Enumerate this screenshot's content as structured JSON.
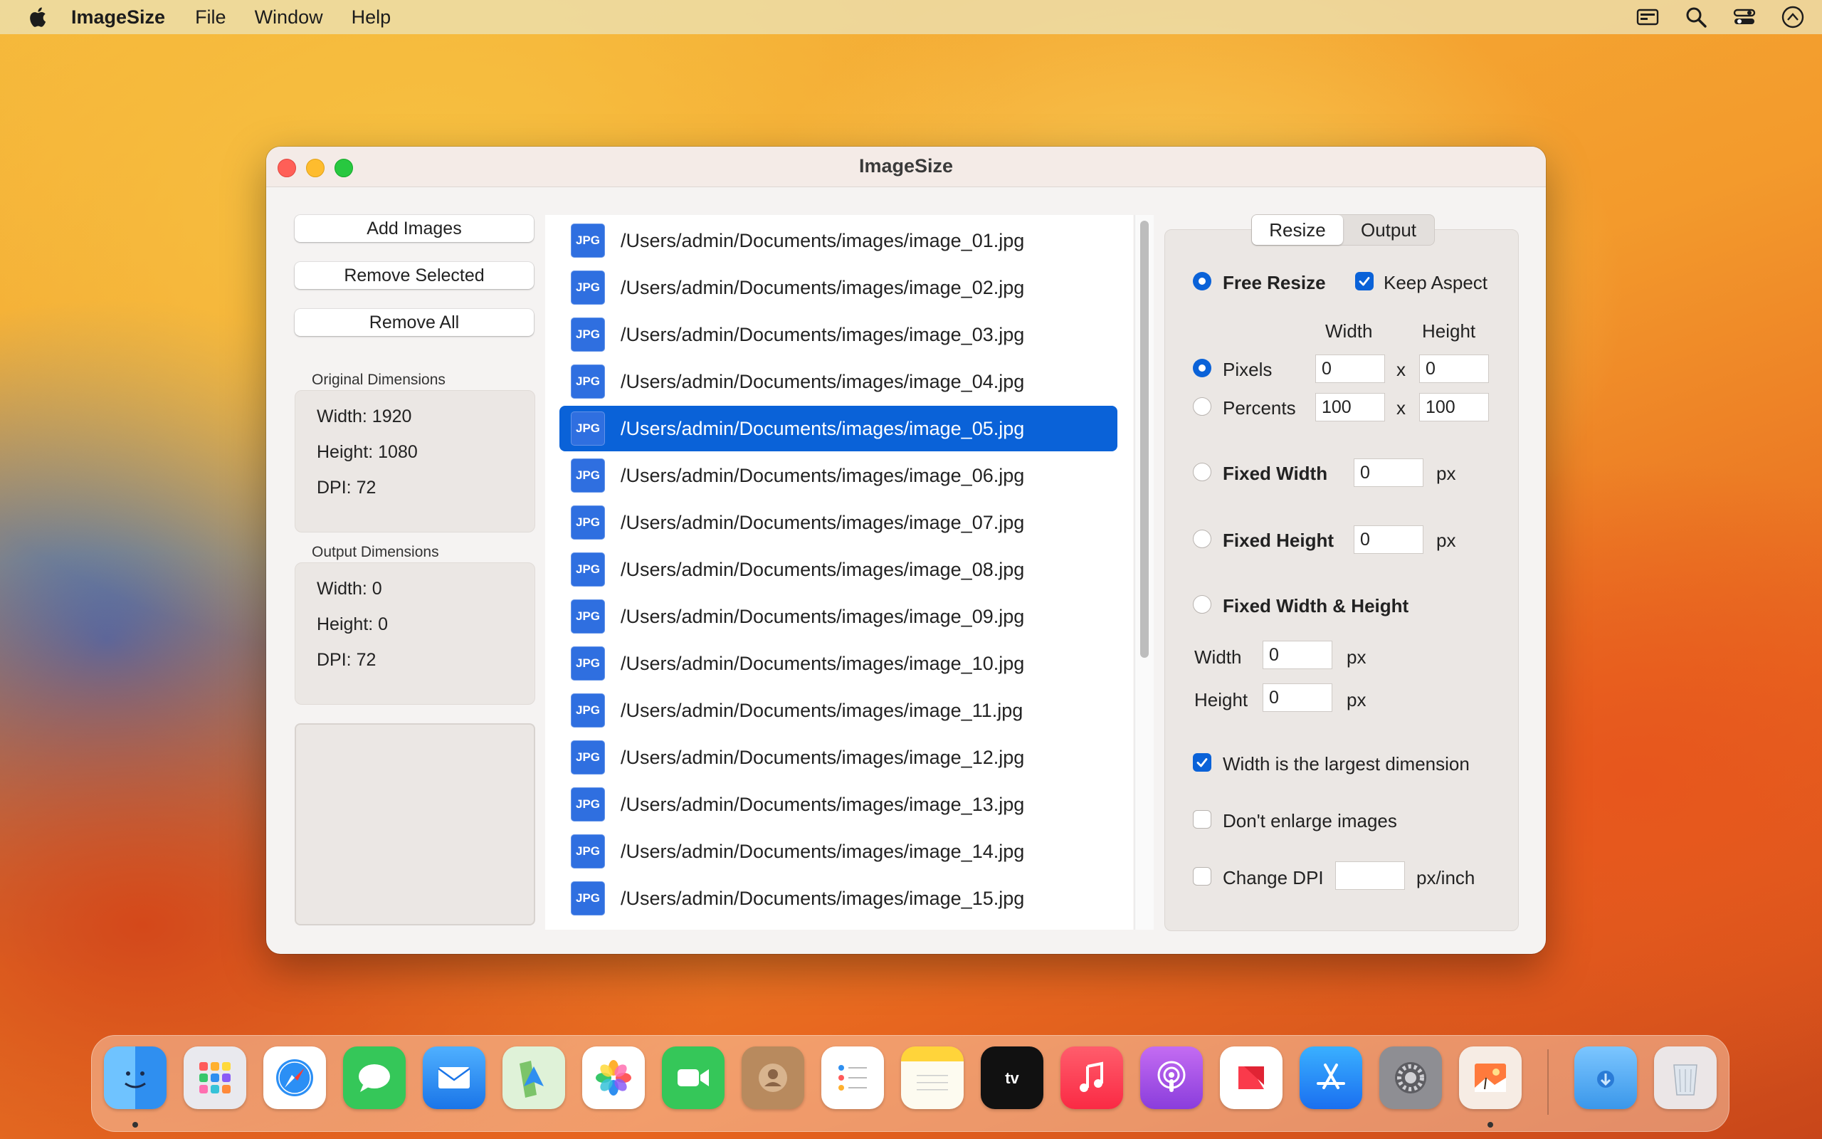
{
  "menubar": {
    "app_name": "ImageSize",
    "menus": [
      "File",
      "Window",
      "Help"
    ]
  },
  "window": {
    "title": "ImageSize"
  },
  "left": {
    "add_images": "Add Images",
    "remove_selected": "Remove Selected",
    "remove_all": "Remove All",
    "original": {
      "label": "Original Dimensions",
      "width": "Width: 1920",
      "height": "Height: 1080",
      "dpi": "DPI: 72"
    },
    "output": {
      "label": "Output Dimensions",
      "width": "Width: 0",
      "height": "Height: 0",
      "dpi": "DPI: 72"
    }
  },
  "files": {
    "badge": "JPG",
    "selected_index": 4,
    "items": [
      "/Users/admin/Documents/images/image_01.jpg",
      "/Users/admin/Documents/images/image_02.jpg",
      "/Users/admin/Documents/images/image_03.jpg",
      "/Users/admin/Documents/images/image_04.jpg",
      "/Users/admin/Documents/images/image_05.jpg",
      "/Users/admin/Documents/images/image_06.jpg",
      "/Users/admin/Documents/images/image_07.jpg",
      "/Users/admin/Documents/images/image_08.jpg",
      "/Users/admin/Documents/images/image_09.jpg",
      "/Users/admin/Documents/images/image_10.jpg",
      "/Users/admin/Documents/images/image_11.jpg",
      "/Users/admin/Documents/images/image_12.jpg",
      "/Users/admin/Documents/images/image_13.jpg",
      "/Users/admin/Documents/images/image_14.jpg",
      "/Users/admin/Documents/images/image_15.jpg"
    ]
  },
  "panel": {
    "tabs": [
      "Resize",
      "Output"
    ],
    "active_tab": "Resize",
    "free_resize": "Free Resize",
    "keep_aspect": "Keep Aspect",
    "col_width": "Width",
    "col_height": "Height",
    "pixels": "Pixels",
    "percents": "Percents",
    "x": "x",
    "pixels_w": "0",
    "pixels_h": "0",
    "percents_w": "100",
    "percents_h": "100",
    "fixed_width": "Fixed Width",
    "fixed_width_val": "0",
    "fixed_height": "Fixed Height",
    "fixed_height_val": "0",
    "px": "px",
    "fixed_wh": "Fixed Width & Height",
    "fwh_width_label": "Width",
    "fwh_width_val": "0",
    "fwh_height_label": "Height",
    "fwh_height_val": "0",
    "width_largest": "Width is the largest dimension",
    "dont_enlarge": "Don't enlarge images",
    "change_dpi": "Change DPI",
    "dpi_val": "",
    "px_inch": "px/inch"
  },
  "dock": {
    "apps": [
      "Finder",
      "Launchpad",
      "Safari",
      "Messages",
      "Mail",
      "Maps",
      "Photos",
      "FaceTime",
      "Contacts",
      "Reminders",
      "Notes",
      "TV",
      "Music",
      "Podcasts",
      "News",
      "App Store",
      "System Settings",
      "ImageSize",
      "Downloads",
      "Trash"
    ]
  },
  "colors": {
    "accent": "#0a62d8",
    "file_badge": "#2f6fe0"
  }
}
